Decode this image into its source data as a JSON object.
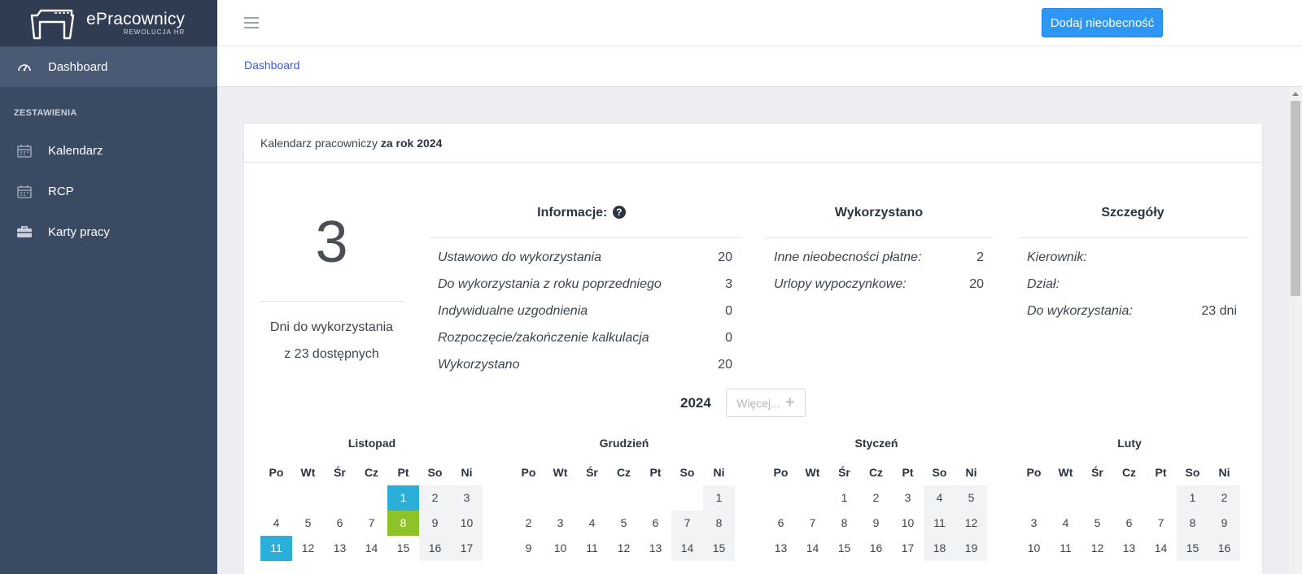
{
  "brand": {
    "name": "ePracownicy",
    "sub": "REWOLUCJA HR"
  },
  "sidebar": {
    "dashboard": "Dashboard",
    "section": "ZESTAWIENIA",
    "items": [
      {
        "label": "Kalendarz",
        "icon": "calendar-icon"
      },
      {
        "label": "RCP",
        "icon": "calendar-icon"
      },
      {
        "label": "Karty pracy",
        "icon": "briefcase-icon"
      }
    ]
  },
  "topbar": {
    "add_absence": "Dodaj nieobecność"
  },
  "breadcrumb": "Dashboard",
  "card": {
    "title_prefix": "Kalendarz pracowniczy",
    "title_bold": "za rok 2024",
    "big_number": "3",
    "big_caption_1": "Dni do wykorzystania",
    "big_caption_2": "z 23 dostępnych"
  },
  "info": {
    "title": "Informacje:",
    "rows": [
      {
        "label": "Ustawowo do wykorzystania",
        "value": "20"
      },
      {
        "label": "Do wykorzystania z roku poprzedniego",
        "value": "3"
      },
      {
        "label": "Indywidualne uzgodnienia",
        "value": "0"
      },
      {
        "label": "Rozpoczęcie/zakończenie kalkulacja",
        "value": "0"
      },
      {
        "label": "Wykorzystano",
        "value": "20"
      }
    ]
  },
  "used": {
    "title": "Wykorzystano",
    "rows": [
      {
        "label": "Inne nieobecności płatne:",
        "value": "2"
      },
      {
        "label": "Urlopy wypoczynkowe:",
        "value": "20"
      }
    ]
  },
  "details": {
    "title": "Szczegóły",
    "rows": [
      {
        "label": "Kierownik:",
        "value": ""
      },
      {
        "label": "Dział:",
        "value": ""
      },
      {
        "label": "Do wykorzystania:",
        "value": "23 dni"
      }
    ]
  },
  "year": {
    "label": "2024",
    "more": "Więcej..."
  },
  "weekdays": [
    "Po",
    "Wt",
    "Śr",
    "Cz",
    "Pt",
    "So",
    "Ni"
  ],
  "months": [
    {
      "name": "Listopad",
      "offset": 4,
      "days": 17,
      "highlights": {
        "1": "blue",
        "8": "green",
        "11": "blue"
      }
    },
    {
      "name": "Grudzień",
      "offset": 6,
      "days": 15,
      "highlights": {}
    },
    {
      "name": "Styczeń",
      "offset": 2,
      "days": 19,
      "highlights": {}
    },
    {
      "name": "Luty",
      "offset": 5,
      "days": 16,
      "highlights": {}
    }
  ],
  "colors": {
    "sidebar": "#3b4a63",
    "accent": "#2d97f3",
    "day_blue": "#2ab0d8",
    "day_green": "#8ec229"
  }
}
